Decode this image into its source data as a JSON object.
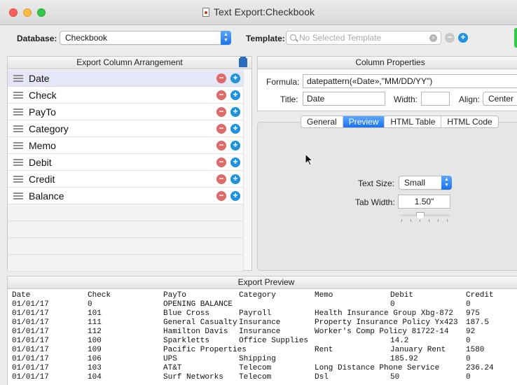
{
  "window": {
    "title": "Text Export:Checkbook"
  },
  "toolbar": {
    "database_label": "Database:",
    "database_value": "Checkbook",
    "template_label": "Template:",
    "template_placeholder": "No Selected Template"
  },
  "left_panel": {
    "title": "Export Column Arrangement",
    "columns": [
      "Date",
      "Check",
      "PayTo",
      "Category",
      "Memo",
      "Debit",
      "Credit",
      "Balance"
    ]
  },
  "right_panel": {
    "title": "Column Properties",
    "formula_label": "Formula:",
    "formula_value": "datepattern(«Date»,\"MM/DD/YY\")",
    "title_label": "Title:",
    "title_value": "Date",
    "width_label": "Width:",
    "width_value": "",
    "align_label": "Align:",
    "align_value": "Center",
    "tabs": [
      "General",
      "Preview",
      "HTML Table",
      "HTML Code"
    ],
    "active_tab": "Preview",
    "text_size_label": "Text Size:",
    "text_size_value": "Small",
    "tab_width_label": "Tab Width:",
    "tab_width_value": "1.50\""
  },
  "export_preview": {
    "title": "Export Preview",
    "headers": [
      "Date",
      "Check",
      "PayTo",
      "Category",
      "Memo",
      "Debit",
      "Credit"
    ],
    "rows": [
      [
        "01/01/17",
        "0",
        "OPENING BALANCE",
        "",
        "",
        "0",
        "0"
      ],
      [
        "01/01/17",
        "101",
        "Blue Cross",
        "Payroll",
        "Health Insurance Group Xbg-872",
        "",
        "975"
      ],
      [
        "01/01/17",
        "111",
        "General Casualty",
        "Insurance",
        "Property Insurance Policy Yx423",
        "",
        "187.5"
      ],
      [
        "01/01/17",
        "112",
        "Hamilton Davis",
        "Insurance",
        "Worker's Comp Policy 81722-14",
        "",
        "92"
      ],
      [
        "01/01/17",
        "100",
        "Sparkletts",
        "Office Supplies",
        "",
        "14.2",
        "0"
      ],
      [
        "01/01/17",
        "109",
        "Pacific Properties",
        "",
        "Rent",
        "January Rent",
        "1580"
      ],
      [
        "01/01/17",
        "106",
        "UPS",
        "Shipping",
        "",
        "185.92",
        "0"
      ],
      [
        "01/01/17",
        "103",
        "AT&T",
        "Telecom",
        "Long Distance Phone Service",
        "",
        "236.24"
      ],
      [
        "01/01/17",
        "104",
        "Surf Networks",
        "Telecom",
        "Dsl",
        "50",
        "0"
      ]
    ]
  },
  "colors": {
    "accent_blue": "#1a72ec",
    "remove_red": "#de6a6a",
    "add_blue": "#1f93e0",
    "selected_row": "#e5e7f8"
  }
}
